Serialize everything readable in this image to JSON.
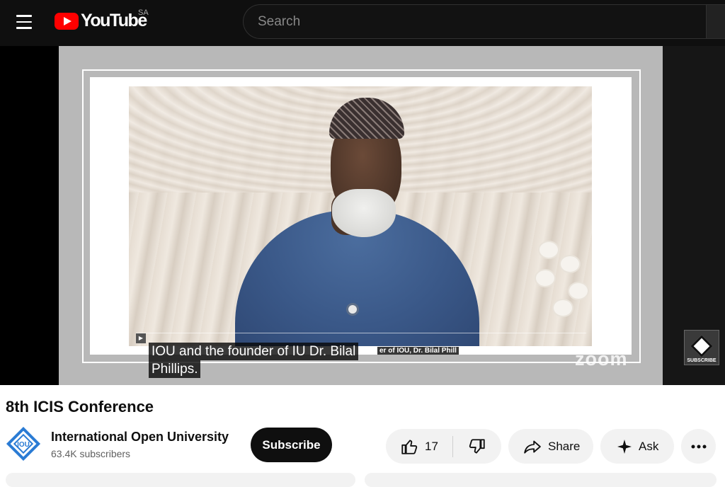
{
  "header": {
    "logo_text": "YouTube",
    "country_code": "SA",
    "search_placeholder": "Search"
  },
  "player": {
    "caption_line1": "IOU and the founder of IU Dr. Bilal",
    "caption_line2": "Phillips.",
    "nameplate": "er of IOU, Dr. Bilal Phill",
    "zoom_watermark": "zoom",
    "subscribe_watermark": "SUBSCRIBE"
  },
  "video": {
    "title": "8th ICIS Conference"
  },
  "channel": {
    "name": "International Open University",
    "subscribers": "63.4K subscribers",
    "avatar_text": "IOU",
    "subscribe_label": "Subscribe"
  },
  "actions": {
    "like_count": "17",
    "share_label": "Share",
    "ask_label": "Ask"
  },
  "colors": {
    "brand_red": "#ff0000",
    "header_bg": "#0f0f0f",
    "iou_blue": "#2a7bd4"
  }
}
